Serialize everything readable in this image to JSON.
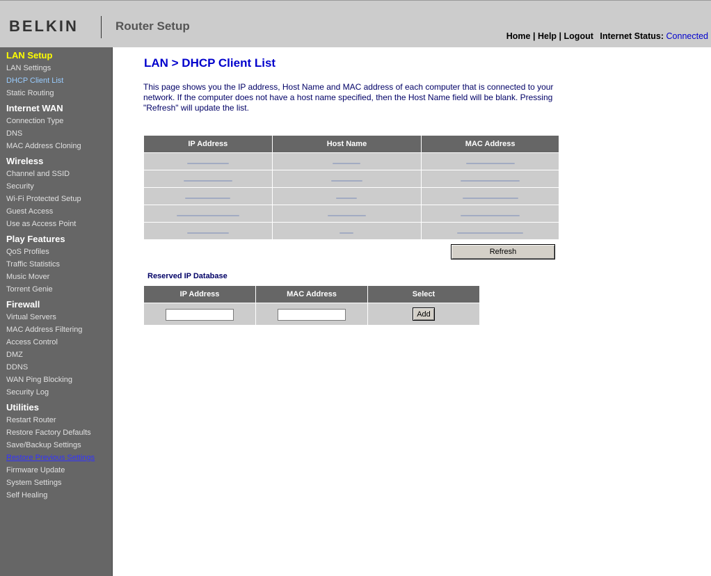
{
  "header": {
    "logo": "BELKIN",
    "app_title": "Router Setup",
    "nav": {
      "home": "Home",
      "help": "Help",
      "logout": "Logout",
      "sep": "|"
    },
    "status_label": "Internet Status:",
    "status_value": "Connected"
  },
  "sidebar": [
    {
      "type": "head",
      "label": "LAN Setup",
      "active": true
    },
    {
      "type": "item",
      "label": "LAN Settings"
    },
    {
      "type": "item",
      "label": "DHCP Client List",
      "active": true
    },
    {
      "type": "item",
      "label": "Static Routing"
    },
    {
      "type": "head",
      "label": "Internet WAN"
    },
    {
      "type": "item",
      "label": "Connection Type"
    },
    {
      "type": "item",
      "label": "DNS"
    },
    {
      "type": "item",
      "label": "MAC Address Cloning"
    },
    {
      "type": "head",
      "label": "Wireless"
    },
    {
      "type": "item",
      "label": "Channel and SSID"
    },
    {
      "type": "item",
      "label": "Security"
    },
    {
      "type": "item",
      "label": "Wi-Fi Protected Setup"
    },
    {
      "type": "item",
      "label": "Guest Access"
    },
    {
      "type": "item",
      "label": "Use as Access Point"
    },
    {
      "type": "head",
      "label": "Play Features"
    },
    {
      "type": "item",
      "label": "QoS Profiles"
    },
    {
      "type": "item",
      "label": "Traffic Statistics"
    },
    {
      "type": "item",
      "label": "Music Mover"
    },
    {
      "type": "item",
      "label": "Torrent Genie"
    },
    {
      "type": "head",
      "label": "Firewall"
    },
    {
      "type": "item",
      "label": "Virtual Servers"
    },
    {
      "type": "item",
      "label": "MAC Address Filtering"
    },
    {
      "type": "item",
      "label": "Access Control"
    },
    {
      "type": "item",
      "label": "DMZ"
    },
    {
      "type": "item",
      "label": "DDNS"
    },
    {
      "type": "item",
      "label": "WAN Ping Blocking"
    },
    {
      "type": "item",
      "label": "Security Log"
    },
    {
      "type": "head",
      "label": "Utilities"
    },
    {
      "type": "item",
      "label": "Restart Router"
    },
    {
      "type": "item",
      "label": "Restore Factory Defaults"
    },
    {
      "type": "item",
      "label": "Save/Backup Settings"
    },
    {
      "type": "item",
      "label": "Restore Previous Settings",
      "link": true
    },
    {
      "type": "item",
      "label": "Firmware Update"
    },
    {
      "type": "item",
      "label": "System Settings"
    },
    {
      "type": "item",
      "label": "Self Healing"
    }
  ],
  "main": {
    "title": "LAN > DHCP Client List",
    "description": "This page shows you the IP address, Host Name and MAC address of each computer that is connected to your network. If the computer does not have a host name specified, then the Host Name field will be blank. Pressing \"Refresh\" will update the list.",
    "client_table": {
      "headers": [
        "IP Address",
        "Host Name",
        "MAC Address"
      ],
      "row_count": 5
    },
    "refresh_label": "Refresh",
    "reserved": {
      "title": "Reserved IP Database",
      "headers": [
        "IP Address",
        "MAC Address",
        "Select"
      ],
      "ip_value": "",
      "mac_value": "",
      "add_label": "Add"
    }
  }
}
